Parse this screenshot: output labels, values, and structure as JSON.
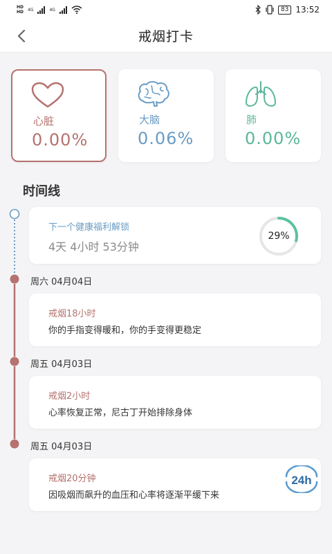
{
  "status_bar": {
    "hd1": "HD",
    "hd2": "HD",
    "net1": "4G",
    "net2": "4G",
    "battery": "83",
    "time": "13:52"
  },
  "header": {
    "title": "戒烟打卡"
  },
  "organs": [
    {
      "name": "心脏",
      "value": "0.00%",
      "color": "#b5726f",
      "icon": "heart-icon"
    },
    {
      "name": "大脑",
      "value": "0.06%",
      "color": "#6a9cc4",
      "icon": "brain-icon"
    },
    {
      "name": "肺",
      "value": "0.00%",
      "color": "#5bb79a",
      "icon": "lungs-icon"
    }
  ],
  "timeline": {
    "title": "时间线",
    "next_unlock": {
      "label": "下一个健康福利解锁",
      "remaining": "4天 4小时 53分钟",
      "progress_percent": 29,
      "progress_label": "29%"
    },
    "entries": [
      {
        "date": "周六 04月04日",
        "title": "戒烟18小时",
        "desc": "你的手指变得暖和，你的手变得更稳定"
      },
      {
        "date": "周五 04月03日",
        "title": "戒烟2小时",
        "desc": "心率恢复正常，尼古丁开始排除身体"
      },
      {
        "date": "周五 04月03日",
        "title": "戒烟20分钟",
        "desc": "因吸烟而飙升的血压和心率将逐渐平缓下来",
        "badge": "24h"
      }
    ]
  },
  "colors": {
    "accent_red": "#b5726f",
    "accent_blue": "#6a9cc4",
    "accent_green": "#5bb79a",
    "progress_arc": "#5bc39e",
    "progress_track": "#e6e6e6"
  }
}
